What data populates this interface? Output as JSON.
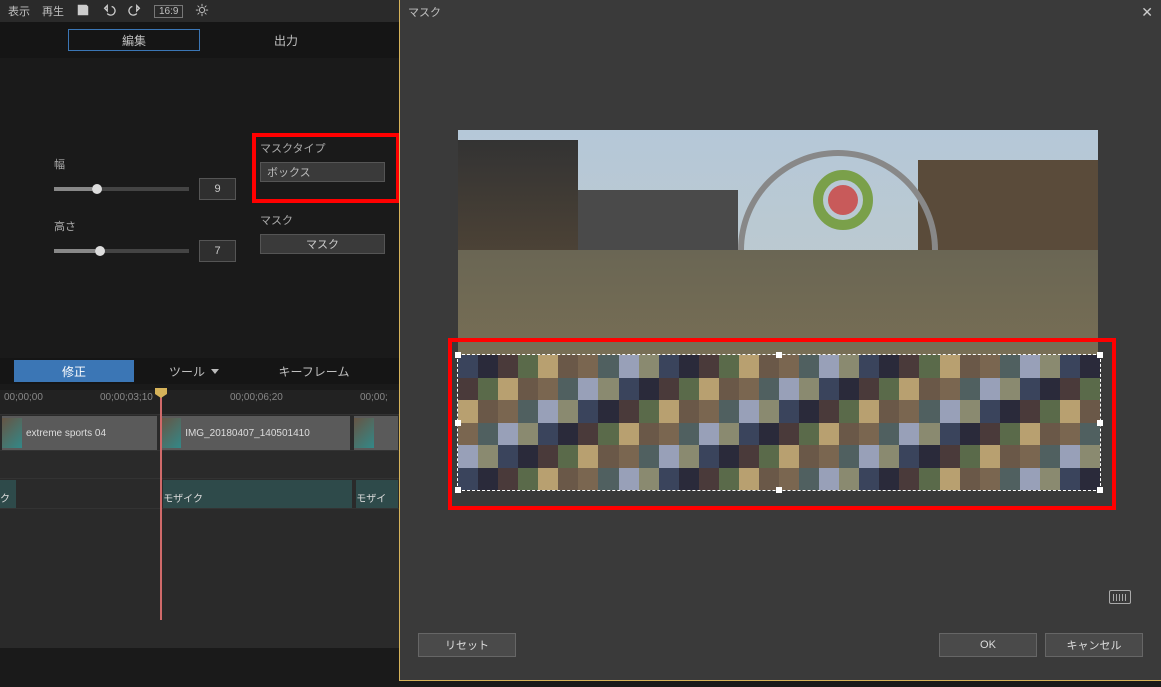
{
  "toolbar": {
    "display": "表示",
    "playback": "再生",
    "aspect_ratio": "16:9"
  },
  "tabs": {
    "edit": "編集",
    "output": "出力"
  },
  "panel": {
    "width_label": "幅",
    "height_label": "高さ",
    "width_value": "9",
    "height_value": "7",
    "mask_type_label": "マスクタイプ",
    "mask_type_value": "ボックス",
    "mask_label": "マスク",
    "mask_button": "マスク"
  },
  "subtabs": {
    "fix": "修正",
    "tool": "ツール",
    "keyframe": "キーフレーム"
  },
  "timeline": {
    "t0": "00;00;00",
    "t1": "00;00;03;10",
    "t2": "00;00;06;20",
    "t3": "00;00;",
    "clip1": "extreme sports 04",
    "clip2": "IMG_20180407_140501410",
    "mosaic": "モザイク",
    "mosaic_short": "ク",
    "mosaic2": "モザイ"
  },
  "dialog": {
    "title": "マスク",
    "reset": "リセット",
    "ok": "OK",
    "cancel": "キャンセル"
  }
}
